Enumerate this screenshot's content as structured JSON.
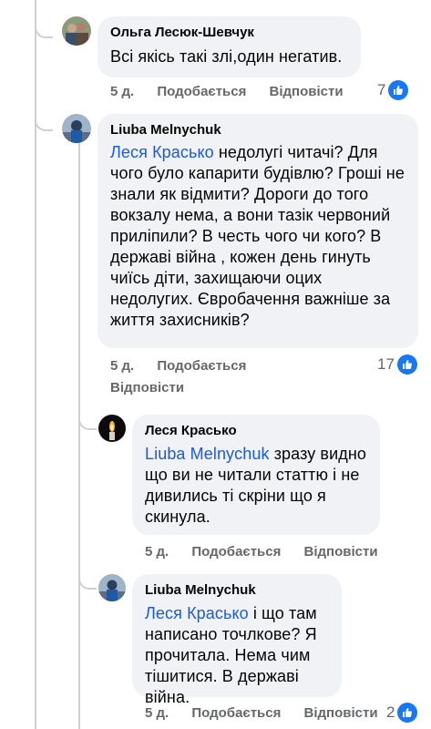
{
  "comments": [
    {
      "author": "Ольга Лесюк-Шевчук",
      "text": "Всі якісь такі злі,один негатив.",
      "time": "5 д.",
      "like_label": "Подобається",
      "reply_label": "Відповісти",
      "reaction_count": "7"
    },
    {
      "author": "Liuba Melnychuk",
      "mention": "Леся Красько",
      "text": " недолугі читачі? Для чого було капарити будівлю? Гроші не знали як відмити? Дороги до того вокзалу нема, а вони  тазік червоний приліпили? В честь чого чи кого? В державі війна , кожен день гинуть чиїсь діти, захищаючи оцих недолугих.  Євробачення важніше за життя захисників?",
      "time": "5 д.",
      "like_label": "Подобається",
      "reply_label": "Відповісти",
      "reaction_count": "17"
    },
    {
      "author": "Леся Красько",
      "mention": "Liuba Melnychuk",
      "text": " зразу видно що ви не читали статтю і не дивились ті скріни що я скинула.",
      "time": "5 д.",
      "like_label": "Подобається",
      "reply_label": "Відповісти"
    },
    {
      "author": "Liuba Melnychuk",
      "mention": "Леся Красько",
      "text": " і що там написано точлкове? Я прочитала. Нема чим тішитися. В державі війна.",
      "time": "5 д.",
      "like_label": "Подобається",
      "reply_label": "Відповісти",
      "reaction_count": "2"
    }
  ],
  "colors": {
    "bubble": "#f0f2f5",
    "mention": "#1b5bd8",
    "meta": "#65676b",
    "like": "#1877f2"
  },
  "icons": [
    "avatar",
    "thumbs-up-icon",
    "candle-avatar"
  ]
}
